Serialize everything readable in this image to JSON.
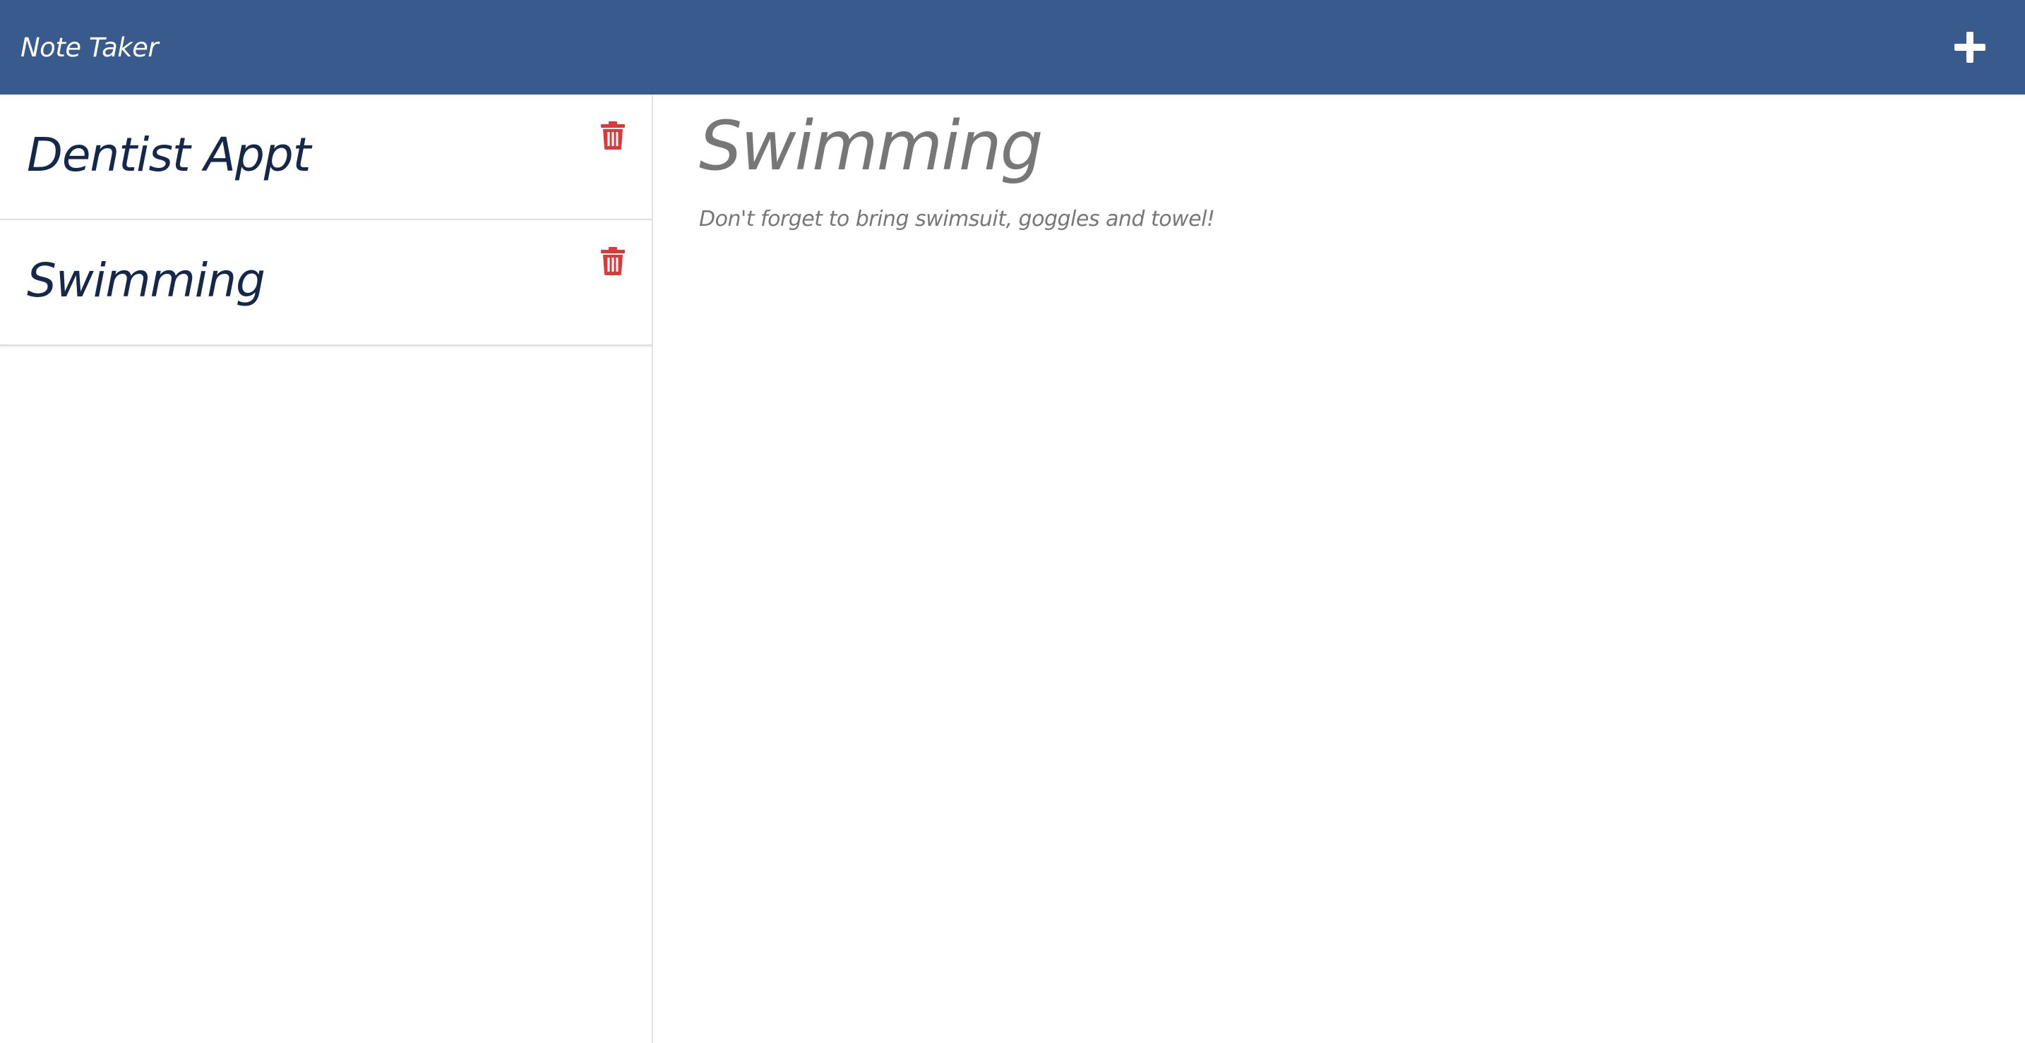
{
  "app": {
    "brand": "Note Taker"
  },
  "colors": {
    "navbar": "#395a8c",
    "note_title": "#14284b",
    "delete_icon": "#dc3a3a",
    "editor_text": "#777777"
  },
  "navbar": {
    "add_icon": "plus-icon"
  },
  "notes": [
    {
      "title": "Dentist Appt",
      "delete_icon": "trash-icon"
    },
    {
      "title": "Swimming",
      "delete_icon": "trash-icon"
    }
  ],
  "editor": {
    "title": "Swimming",
    "body": "Don't forget to bring swimsuit, goggles and towel!"
  }
}
